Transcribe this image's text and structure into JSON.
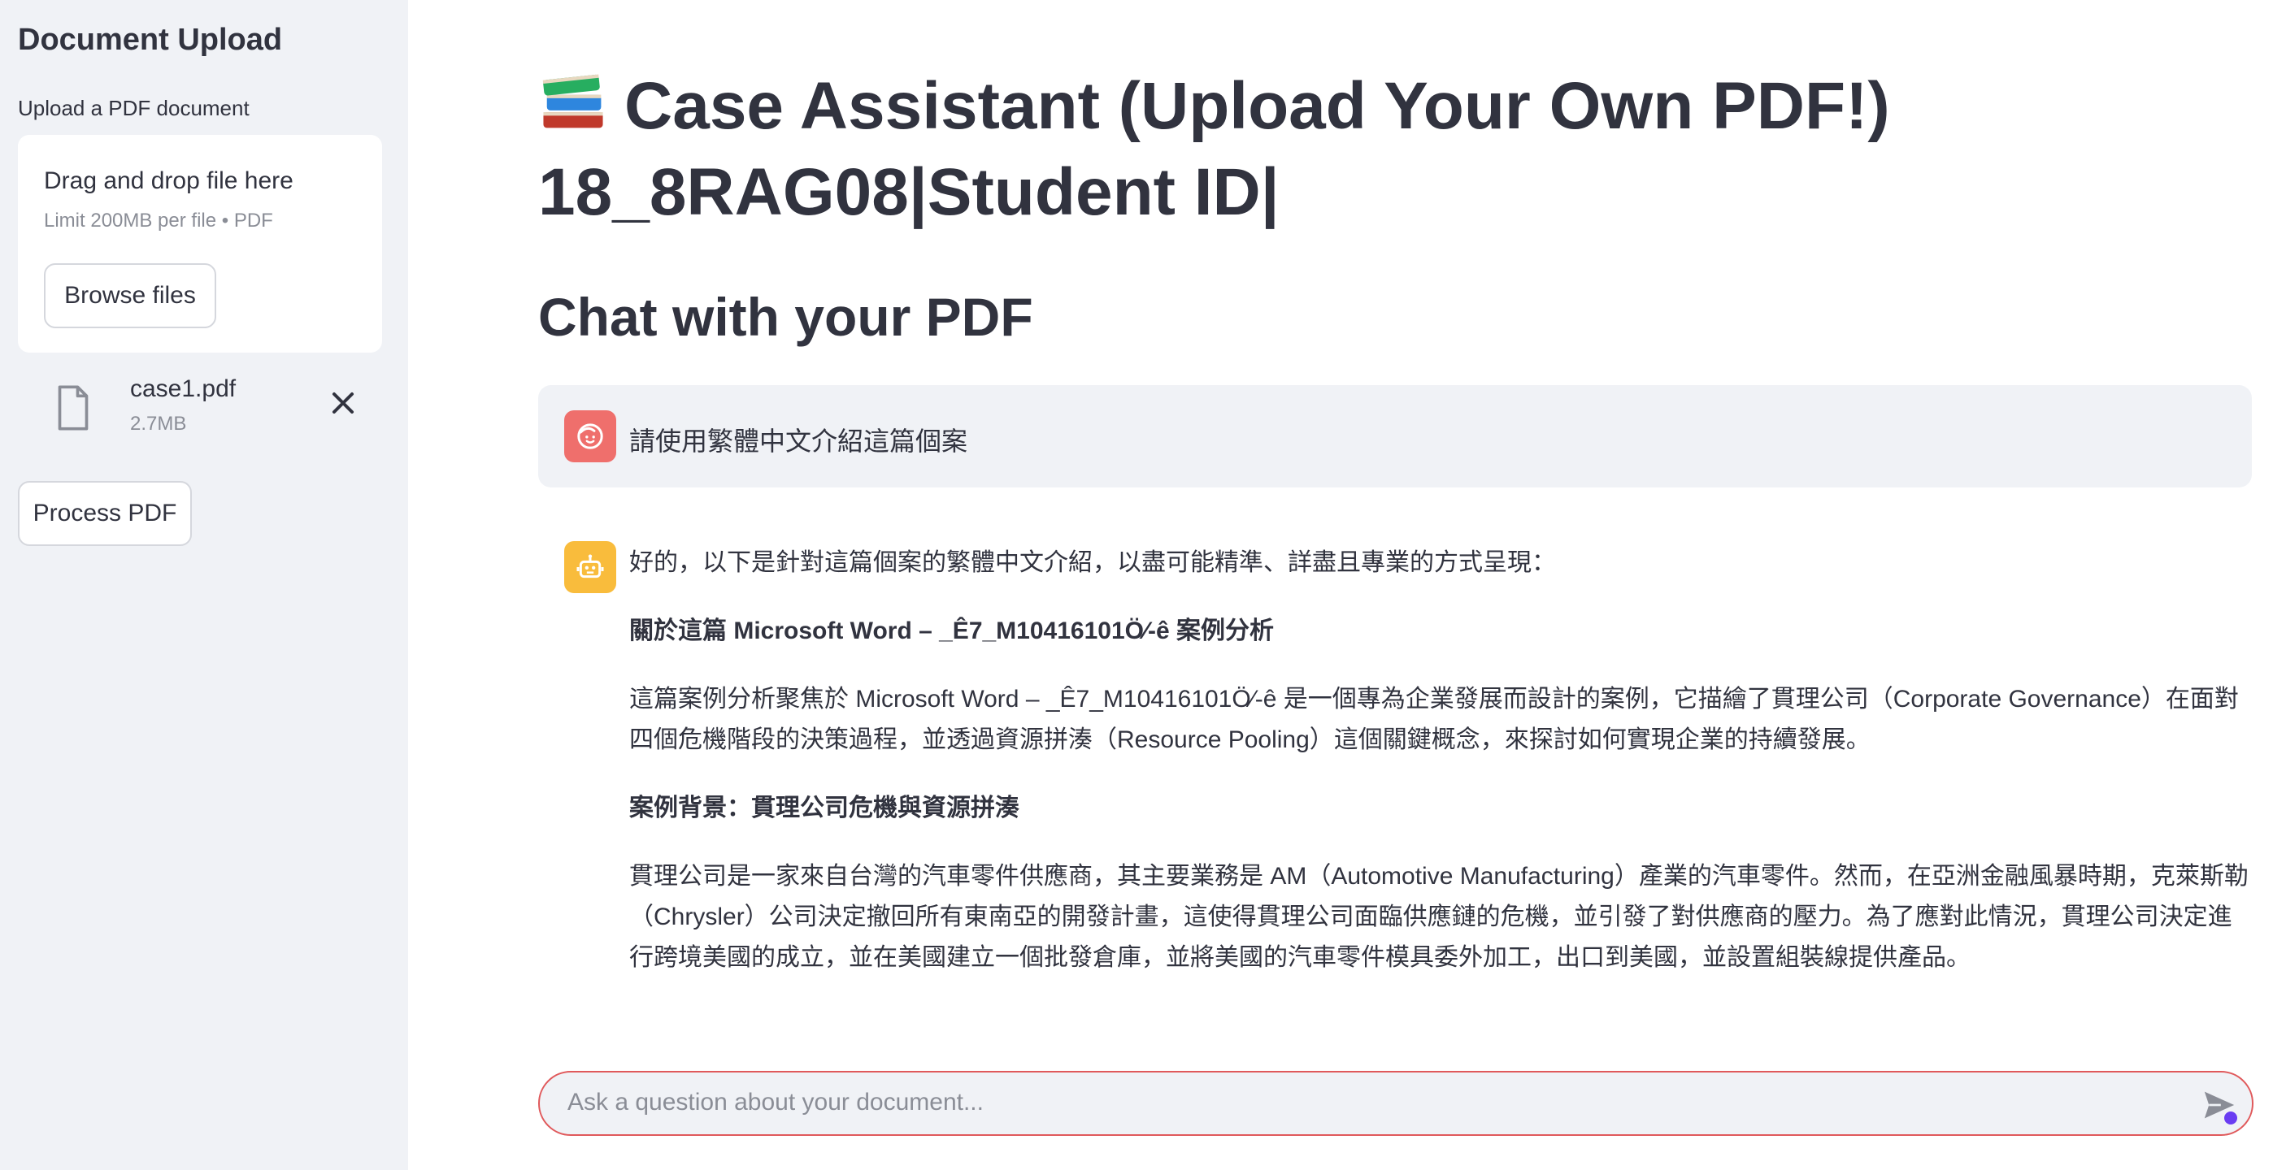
{
  "sidebar": {
    "title": "Document Upload",
    "upload_label": "Upload a PDF document",
    "dropzone": {
      "title": "Drag and drop file here",
      "limit": "Limit 200MB per file • PDF",
      "browse_label": "Browse files"
    },
    "file": {
      "name": "case1.pdf",
      "size": "2.7MB",
      "icon": "file-icon"
    },
    "process_label": "Process PDF"
  },
  "main": {
    "title": "Case Assistant (Upload Your Own PDF!) 18_8RAG08|Student ID|",
    "title_icon": "books-emoji-icon",
    "subheader": "Chat with your PDF"
  },
  "chat": {
    "user_message": "請使用繁體中文介紹這篇個案",
    "assistant": {
      "intro": "好的，以下是針對這篇個案的繁體中文介紹，以盡可能精準、詳盡且專業的方式呈現：",
      "heading1": "關於這篇 Microsoft Word – _Ê7_M10416101Ö⁄-ê 案例分析",
      "para1": "這篇案例分析聚焦於 Microsoft Word – _Ê7_M10416101Ö⁄-ê 是一個專為企業發展而設計的案例，它描繪了貫理公司（Corporate Governance）在面對四個危機階段的決策過程，並透過資源拼湊（Resource Pooling）這個關鍵概念，來探討如何實現企業的持續發展。",
      "heading2": "案例背景：貫理公司危機與資源拼湊",
      "para2": "貫理公司是一家來自台灣的汽車零件供應商，其主要業務是 AM（Automotive Manufacturing）產業的汽車零件。然而，在亞洲金融風暴時期，克萊斯勒（Chrysler）公司決定撤回所有東南亞的開發計畫，這使得貫理公司面臨供應鏈的危機，並引發了對供應商的壓力。為了應對此情況，貫理公司決定進行跨境美國的成立，並在美國建立一個批發倉庫，並將美國的汽車零件模具委外加工，出口到美國，並設置組裝線提供產品。"
    },
    "input_placeholder": "Ask a question about your document..."
  },
  "colors": {
    "sidebar_bg": "#f0f2f6",
    "user_avatar": "#ef6f6c",
    "bot_avatar": "#f9bc3c",
    "input_border": "#e0595b",
    "accent": "#6a3df2"
  }
}
